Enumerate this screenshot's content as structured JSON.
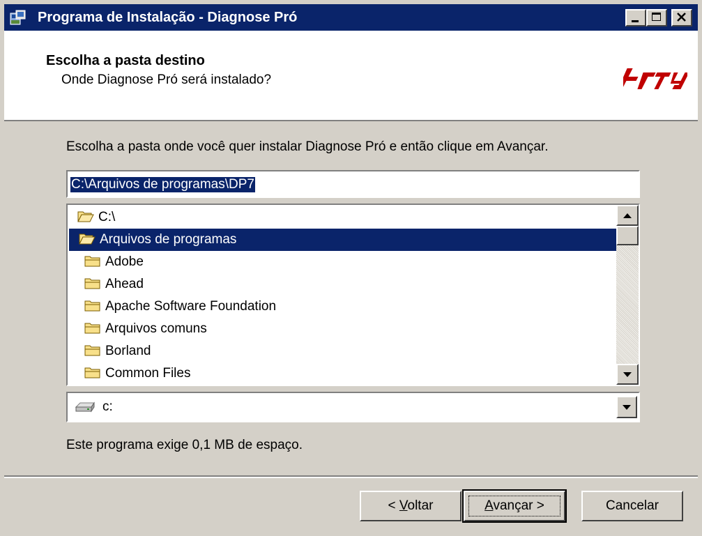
{
  "window": {
    "title": "Programa de Instalação - Diagnose Pró",
    "icons": [
      "setup-icon",
      "minimize-icon",
      "maximize-icon",
      "close-icon"
    ]
  },
  "header": {
    "title": "Escolha a pasta destino",
    "subtitle": "Onde Diagnose Pró será instalado?",
    "logo_icon": "brand-logo"
  },
  "content": {
    "instruction": "Escolha a pasta onde você quer instalar Diagnose Pró e então clique em Avançar.",
    "path": "C:\\Arquivos de programas\\DP7",
    "tree": [
      {
        "label": "C:\\",
        "icon": "open-folder-icon"
      },
      {
        "label": "Arquivos de programas",
        "icon": "open-folder-icon",
        "selected": true
      },
      {
        "label": "Adobe",
        "icon": "folder-icon"
      },
      {
        "label": "Ahead",
        "icon": "folder-icon"
      },
      {
        "label": "Apache Software Foundation",
        "icon": "folder-icon"
      },
      {
        "label": "Arquivos comuns",
        "icon": "folder-icon"
      },
      {
        "label": "Borland",
        "icon": "folder-icon"
      },
      {
        "label": "Common Files",
        "icon": "folder-icon"
      }
    ],
    "drive": "c:",
    "space": "Este programa exige 0,1 MB de espaço."
  },
  "buttons": {
    "back": "< Voltar",
    "next": "Avançar >",
    "cancel": "Cancelar"
  },
  "colors": {
    "titlebar": "#0a246a",
    "face": "#d4d0c8",
    "selection": "#0a246a",
    "logo": "#c00000"
  }
}
